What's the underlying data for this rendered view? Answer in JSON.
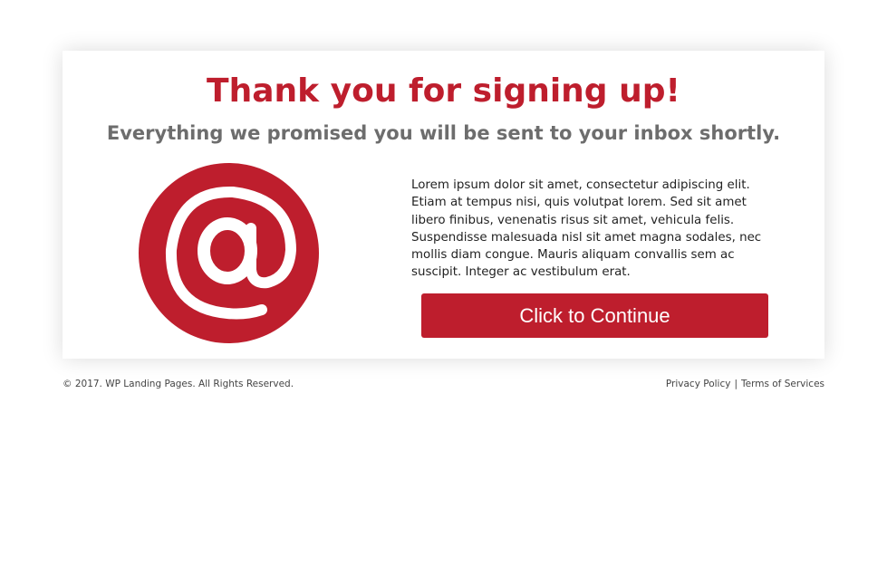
{
  "header": {
    "title": "Thank you for signing up!",
    "subtitle": "Everything we promised you will be sent to your inbox shortly."
  },
  "content": {
    "icon": "at-sign-icon",
    "body": "Lorem ipsum dolor sit amet, consectetur adipiscing elit. Etiam at tempus nisi, quis volutpat lorem. Sed sit amet libero finibus, venenatis risus sit amet, vehicula felis. Suspendisse malesuada nisl sit amet magna sodales, nec mollis diam congue. Mauris aliquam convallis sem ac suscipit. Integer ac vestibulum erat.",
    "cta_label": "Click to Continue"
  },
  "footer": {
    "copyright": "© 2017. WP Landing Pages. All Rights Reserved.",
    "privacy_label": "Privacy Policy",
    "separator": "|",
    "terms_label": "Terms of Services"
  },
  "colors": {
    "accent": "#be1e2d",
    "subtitle": "#6d6d6d",
    "body_text": "#222222",
    "footer_text": "#444444"
  }
}
